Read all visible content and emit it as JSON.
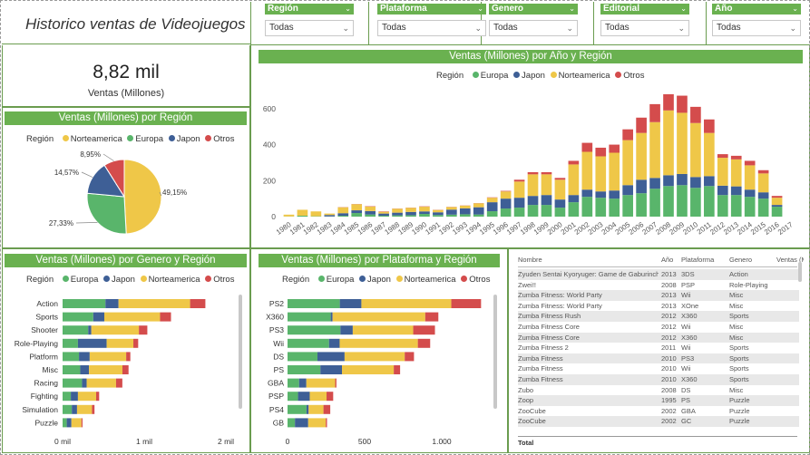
{
  "title": "Historico ventas de Videojuegos",
  "colors": {
    "europa": "#59b56b",
    "japon": "#3e5f96",
    "norteamerica": "#efc748",
    "otros": "#d44c4c",
    "header": "#6ab150"
  },
  "slicers": [
    {
      "label": "Región",
      "value": "Todas"
    },
    {
      "label": "Plataforma",
      "value": "Todas"
    },
    {
      "label": "Genero",
      "value": "Todas"
    },
    {
      "label": "Editorial",
      "value": "Todas"
    },
    {
      "label": "Año",
      "value": "Todas"
    }
  ],
  "kpi": {
    "value": "8,82 mil",
    "label": "Ventas (Millones)"
  },
  "pie": {
    "title": "Ventas (Millones) por Región",
    "legend_title": "Región",
    "legend": [
      "Norteamerica",
      "Europa",
      "Japon",
      "Otros"
    ],
    "labels": [
      "49,15%",
      "27,33%",
      "14,57%",
      "8,95%"
    ],
    "chart_data": {
      "type": "pie",
      "slices": [
        {
          "name": "Norteamerica",
          "value": 49.15,
          "label": "49,15%"
        },
        {
          "name": "Europa",
          "value": 27.33,
          "label": "27,33%"
        },
        {
          "name": "Japon",
          "value": 14.57,
          "label": "14,57%"
        },
        {
          "name": "Otros",
          "value": 8.95,
          "label": "8,95%"
        }
      ]
    }
  },
  "year_chart": {
    "title": "Ventas (Millones) por Año y Región",
    "legend_title": "Región",
    "legend": [
      "Europa",
      "Japon",
      "Norteamerica",
      "Otros"
    ],
    "chart_data": {
      "type": "bar",
      "stacked": true,
      "ylim": [
        0,
        700
      ],
      "yticks": [
        0,
        200,
        400,
        600
      ],
      "categories": [
        "1980",
        "1981",
        "1982",
        "1983",
        "1984",
        "1985",
        "1986",
        "1987",
        "1988",
        "1989",
        "1990",
        "1991",
        "1992",
        "1993",
        "1994",
        "1995",
        "1996",
        "1997",
        "1998",
        "1999",
        "2000",
        "2001",
        "2002",
        "2003",
        "2004",
        "2005",
        "2006",
        "2007",
        "2008",
        "2009",
        "2010",
        "2011",
        "2012",
        "2013",
        "2014",
        "2015",
        "2016",
        "2017"
      ],
      "series": [
        {
          "name": "Europa",
          "values": [
            1,
            5,
            2,
            1,
            5,
            20,
            12,
            5,
            7,
            8,
            15,
            9,
            11,
            13,
            12,
            30,
            45,
            50,
            65,
            65,
            50,
            80,
            110,
            105,
            100,
            120,
            130,
            155,
            170,
            175,
            160,
            170,
            120,
            120,
            110,
            100,
            55,
            0
          ]
        },
        {
          "name": "Japon",
          "values": [
            0,
            0,
            0,
            8,
            14,
            15,
            19,
            12,
            15,
            18,
            14,
            15,
            28,
            33,
            40,
            50,
            55,
            55,
            50,
            55,
            45,
            40,
            40,
            35,
            45,
            55,
            75,
            60,
            60,
            62,
            60,
            55,
            52,
            48,
            40,
            35,
            10,
            0
          ]
        },
        {
          "name": "Norteamerica",
          "values": [
            10,
            33,
            27,
            8,
            33,
            34,
            25,
            10,
            22,
            23,
            26,
            13,
            14,
            15,
            22,
            25,
            40,
            90,
            120,
            115,
            110,
            170,
            210,
            195,
            210,
            250,
            260,
            310,
            360,
            340,
            300,
            240,
            155,
            150,
            135,
            105,
            40,
            0
          ]
        },
        {
          "name": "Otros",
          "values": [
            0,
            0,
            0,
            0,
            1,
            1,
            2,
            2,
            1,
            1,
            2,
            1,
            1,
            1,
            1,
            2,
            3,
            10,
            12,
            12,
            10,
            20,
            50,
            48,
            45,
            60,
            85,
            100,
            90,
            95,
            90,
            75,
            20,
            20,
            25,
            18,
            10,
            0
          ]
        }
      ]
    }
  },
  "genre_chart": {
    "title": "Ventas (Millones) por Genero y Región",
    "legend_title": "Región",
    "legend": [
      "Europa",
      "Japon",
      "Norteamerica",
      "Otros"
    ],
    "chart_data": {
      "type": "bar",
      "orientation": "horizontal",
      "stacked": true,
      "xlim": [
        0,
        2000
      ],
      "xticks": [
        0,
        1000,
        2000
      ],
      "xticklabels": [
        "0 mil",
        "1 mil",
        "2 mil"
      ],
      "categories": [
        "Action",
        "Sports",
        "Shooter",
        "Role-Playing",
        "Platform",
        "Misc",
        "Racing",
        "Fighting",
        "Simulation",
        "Puzzle"
      ],
      "series": [
        {
          "name": "Europa",
          "values": [
            525,
            376,
            314,
            188,
            201,
            216,
            238,
            101,
            113,
            51
          ]
        },
        {
          "name": "Japon",
          "values": [
            160,
            135,
            38,
            352,
            131,
            107,
            57,
            87,
            64,
            57
          ]
        },
        {
          "name": "Norteamerica",
          "values": [
            877,
            683,
            583,
            327,
            447,
            410,
            360,
            223,
            183,
            123
          ]
        },
        {
          "name": "Otros",
          "values": [
            187,
            134,
            103,
            59,
            51,
            75,
            77,
            37,
            31,
            13
          ]
        }
      ]
    }
  },
  "platform_chart": {
    "title": "Ventas (Millones) por Plataforma y Región",
    "legend_title": "Región",
    "legend": [
      "Europa",
      "Japon",
      "Norteamerica",
      "Otros"
    ],
    "chart_data": {
      "type": "bar",
      "orientation": "horizontal",
      "stacked": true,
      "xlim": [
        0,
        1300
      ],
      "xticks": [
        0,
        500,
        1000
      ],
      "xticklabels": [
        "0",
        "500",
        "1.000"
      ],
      "categories": [
        "PS2",
        "X360",
        "PS3",
        "Wii",
        "DS",
        "PS",
        "GBA",
        "PSP",
        "PS4",
        "GB"
      ],
      "series": [
        {
          "name": "Europa",
          "values": [
            339,
            280,
            343,
            269,
            194,
            213,
            75,
            68,
            123,
            48
          ]
        },
        {
          "name": "Japon",
          "values": [
            140,
            12,
            80,
            69,
            176,
            140,
            47,
            76,
            14,
            86
          ]
        },
        {
          "name": "Norteamerica",
          "values": [
            583,
            601,
            392,
            507,
            390,
            336,
            187,
            109,
            96,
            114
          ]
        },
        {
          "name": "Otros",
          "values": [
            193,
            85,
            141,
            80,
            60,
            41,
            8,
            43,
            44,
            8
          ]
        }
      ]
    }
  },
  "table": {
    "headers": [
      "Nombre",
      "Año",
      "Plataforma",
      "Genero",
      "Ventas (M"
    ],
    "rows": [
      [
        "Zyuden Sentai Kyoryuger: Game de Gaburincho!!",
        "2013",
        "3DS",
        "Action"
      ],
      [
        "Zwei!!",
        "2008",
        "PSP",
        "Role-Playing"
      ],
      [
        "Zumba Fitness: World Party",
        "2013",
        "Wii",
        "Misc"
      ],
      [
        "Zumba Fitness: World Party",
        "2013",
        "XOne",
        "Misc"
      ],
      [
        "Zumba Fitness Rush",
        "2012",
        "X360",
        "Sports"
      ],
      [
        "Zumba Fitness Core",
        "2012",
        "Wii",
        "Misc"
      ],
      [
        "Zumba Fitness Core",
        "2012",
        "X360",
        "Misc"
      ],
      [
        "Zumba Fitness 2",
        "2011",
        "Wii",
        "Sports"
      ],
      [
        "Zumba Fitness",
        "2010",
        "PS3",
        "Sports"
      ],
      [
        "Zumba Fitness",
        "2010",
        "Wii",
        "Sports"
      ],
      [
        "Zumba Fitness",
        "2010",
        "X360",
        "Sports"
      ],
      [
        "Zubo",
        "2008",
        "DS",
        "Misc"
      ],
      [
        "Zoop",
        "1995",
        "PS",
        "Puzzle"
      ],
      [
        "ZooCube",
        "2002",
        "GBA",
        "Puzzle"
      ],
      [
        "ZooCube",
        "2002",
        "GC",
        "Puzzle"
      ]
    ],
    "total_label": "Total"
  }
}
